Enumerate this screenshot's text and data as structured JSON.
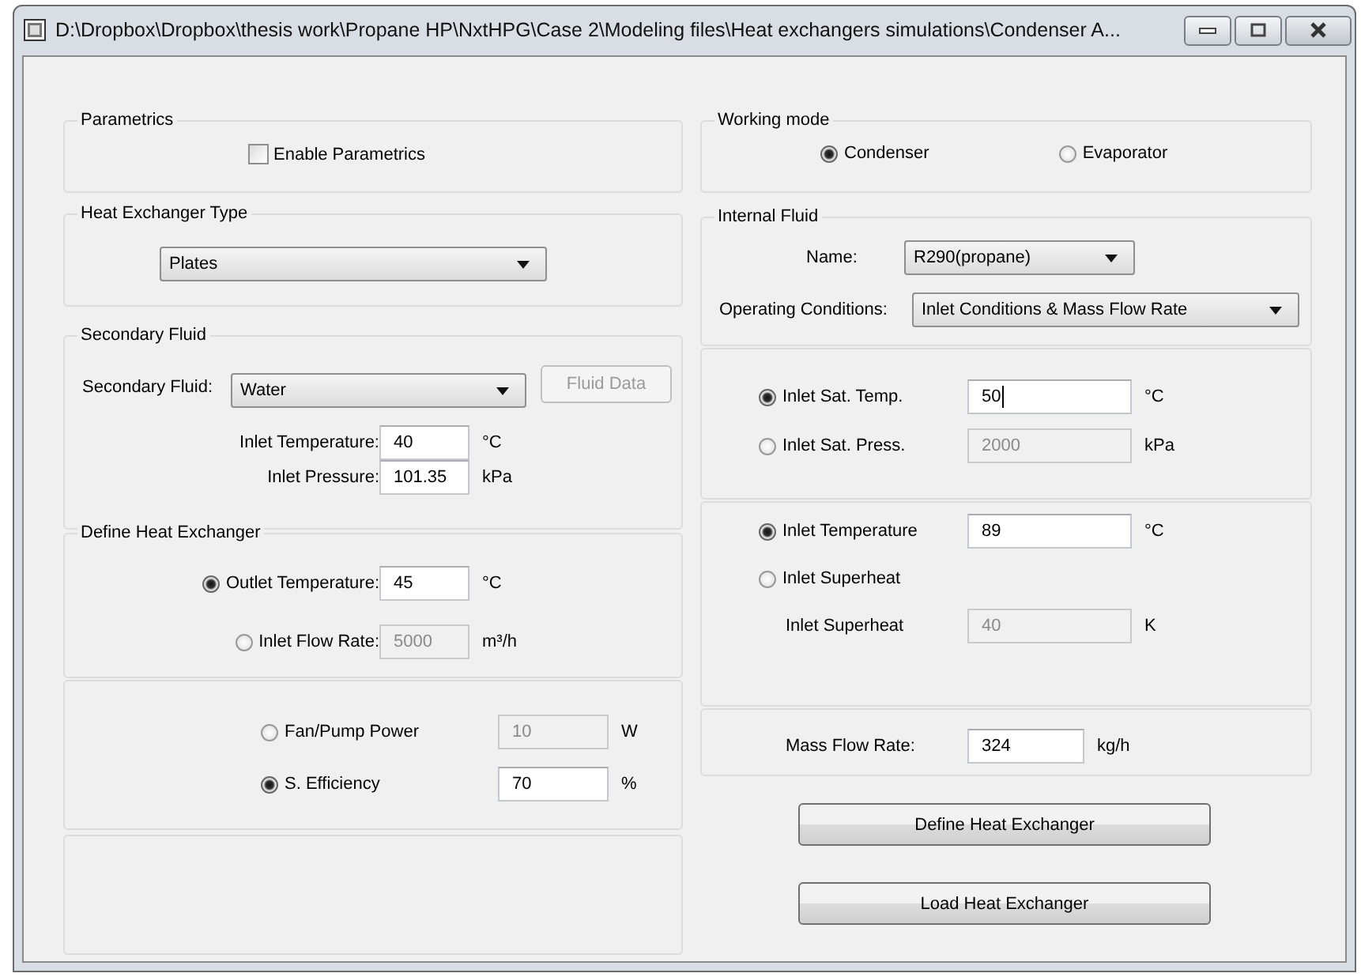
{
  "window": {
    "title": "D:\\Dropbox\\Dropbox\\thesis work\\Propane HP\\NxtHPG\\Case 2\\Modeling files\\Heat exchangers simulations\\Condenser A..."
  },
  "parametrics": {
    "title": "Parametrics",
    "checkbox": {
      "label": "Enable Parametrics",
      "checked": false
    }
  },
  "heat_exchanger_type": {
    "title": "Heat Exchanger Type",
    "value": "Plates"
  },
  "secondary_fluid": {
    "title": "Secondary Fluid",
    "fluid_label": "Secondary Fluid:",
    "fluid_value": "Water",
    "fluid_data_button": {
      "label": "Fluid Data",
      "disabled": true
    },
    "rows": [
      {
        "label": "Inlet Temperature:",
        "value": "40",
        "unit": "°C"
      },
      {
        "label": "Inlet Pressure:",
        "value": "101.35",
        "unit": "kPa"
      }
    ]
  },
  "define_heat_exchanger": {
    "title": "Define Heat Exchanger",
    "rows": [
      {
        "kind": "radio",
        "label": "Outlet Temperature:",
        "value": "45",
        "unit": "°C",
        "selected": true
      },
      {
        "kind": "radio",
        "label": "Inlet Flow Rate:",
        "value": "5000",
        "unit": "m³/h",
        "selected": false
      }
    ]
  },
  "power": {
    "rows": [
      {
        "kind": "radio",
        "label": "Fan/Pump Power",
        "value": "10",
        "unit": "W",
        "selected": false
      },
      {
        "kind": "radio",
        "label": "S. Efficiency",
        "value": "70",
        "unit": "%",
        "selected": true
      }
    ]
  },
  "working_mode": {
    "title": "Working mode",
    "options": [
      {
        "label": "Condenser",
        "selected": true
      },
      {
        "label": "Evaporator",
        "selected": false
      }
    ]
  },
  "internal_fluid": {
    "title": "Internal Fluid",
    "name_label": "Name:",
    "name_value": "R290(propane)",
    "conditions_label": "Operating Conditions:",
    "conditions_value": "Inlet Conditions & Mass Flow Rate"
  },
  "saturation": {
    "rows": [
      {
        "kind": "radio",
        "label": "Inlet Sat. Temp.",
        "value": "50",
        "unit": "°C",
        "selected": true,
        "focused": true
      },
      {
        "kind": "radio",
        "label": "Inlet Sat. Press.",
        "value": "2000",
        "unit": "kPa",
        "selected": false
      }
    ]
  },
  "inlet_state": {
    "rows": [
      {
        "kind": "radio",
        "label": "Inlet Temperature",
        "value": "89",
        "unit": "°C",
        "selected": true
      },
      {
        "kind": "radio",
        "label": "Inlet Superheat",
        "selected": false
      },
      {
        "kind": "field",
        "label": "Inlet Superheat",
        "value": "40",
        "unit": "K",
        "disabled": true
      }
    ]
  },
  "mass_flow": {
    "label": "Mass Flow Rate:",
    "value": "324",
    "unit": "kg/h"
  },
  "buttons": [
    {
      "label": "Define Heat Exchanger"
    },
    {
      "label": "Load Heat Exchanger"
    }
  ]
}
